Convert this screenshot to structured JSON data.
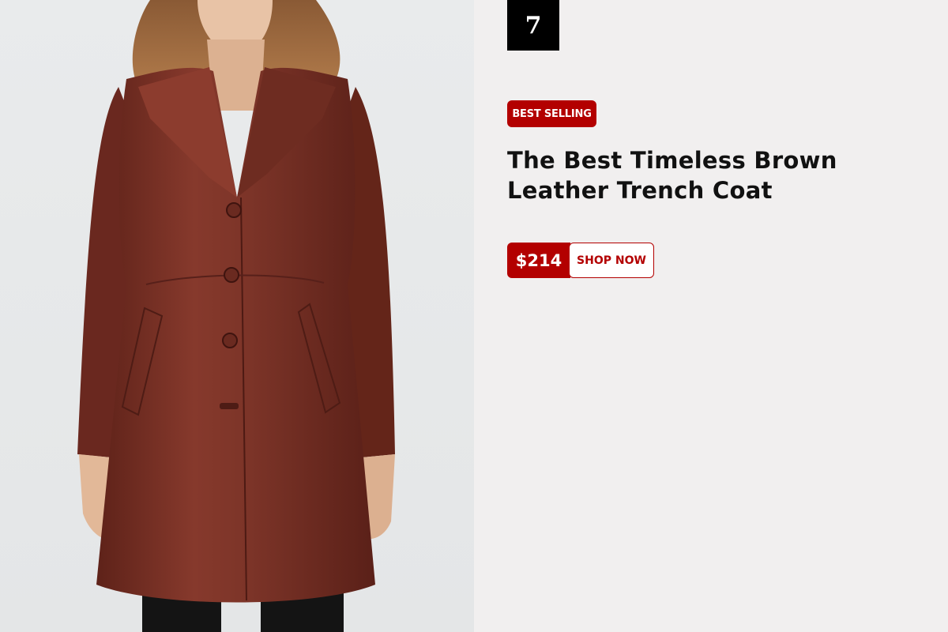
{
  "rank": "7",
  "product": {
    "badge": "BEST SELLING",
    "title": "The Best Timeless Brown Leather Trench Coat",
    "price": "$214",
    "cta_label": "SHOP NOW",
    "image_alt": "Brown leather trench coat worn by model"
  },
  "colors": {
    "accent": "#b30000",
    "rank_bg": "#000000",
    "panel_bg": "#f1efef",
    "coat": "#7a3328"
  }
}
